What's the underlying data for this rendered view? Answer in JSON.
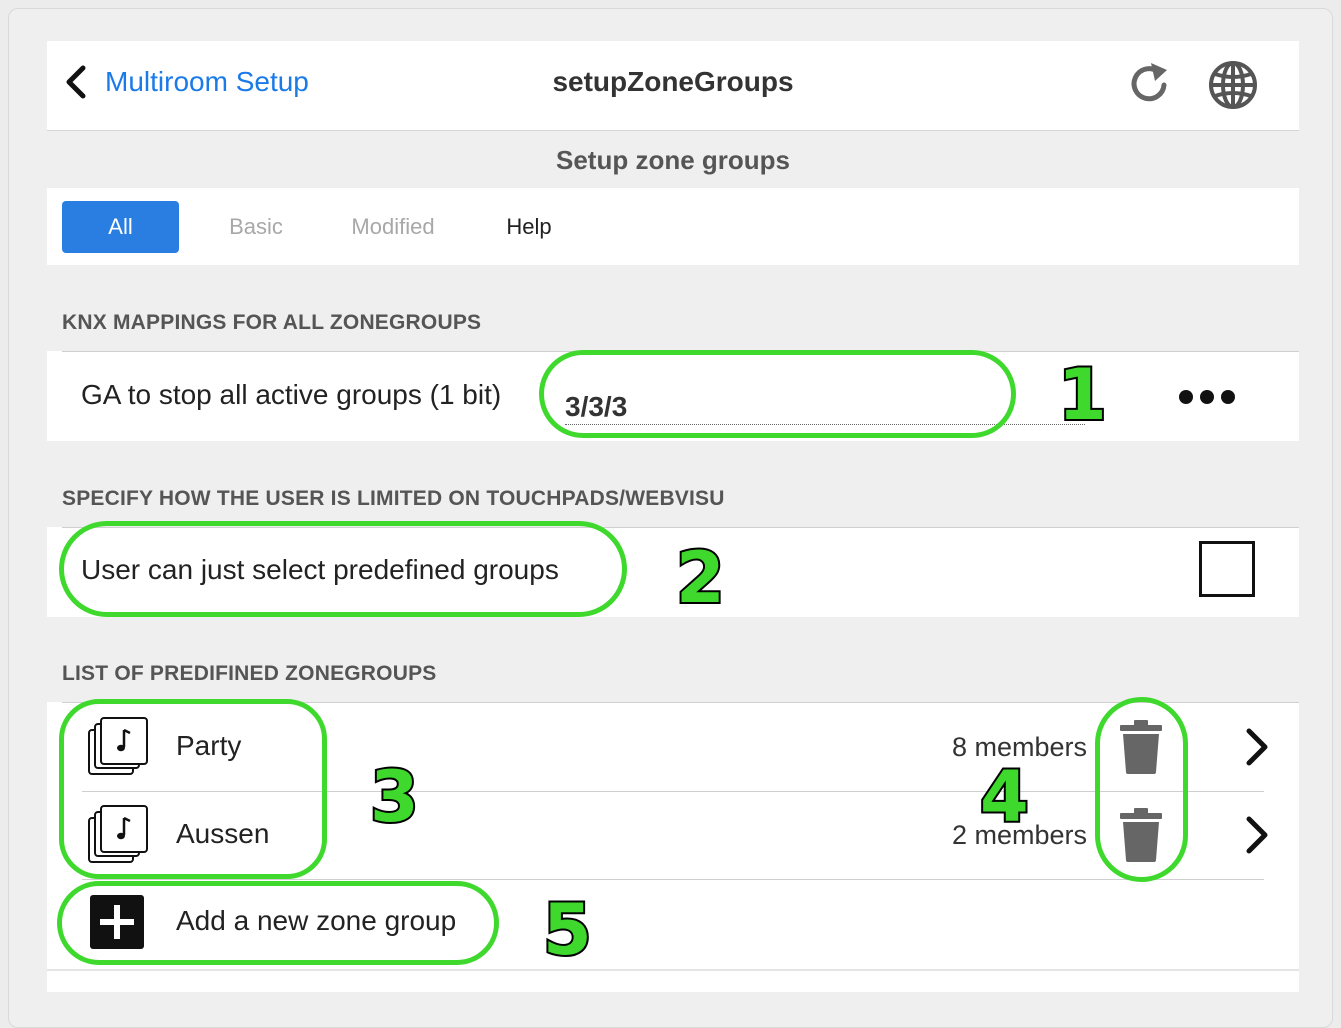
{
  "nav": {
    "back_label": "Multiroom Setup",
    "title": "setupZoneGroups",
    "icons": [
      "chevron-left-icon",
      "reload-icon",
      "globe-icon"
    ]
  },
  "section_title": "Setup zone groups",
  "tabs": [
    {
      "label": "All",
      "state": "active"
    },
    {
      "label": "Basic",
      "state": "dim"
    },
    {
      "label": "Modified",
      "state": "dim"
    },
    {
      "label": "Help",
      "state": "normal"
    }
  ],
  "knx": {
    "header": "KNX MAPPINGS FOR ALL ZONEGROUPS",
    "ga_label": "GA to stop all active groups (1 bit)",
    "ga_value": "3/3/3"
  },
  "limit": {
    "header": "SPECIFY HOW THE USER IS LIMITED ON TOUCHPADS/WEBVISU",
    "option_label": "User can just select predefined groups",
    "checked": false
  },
  "zonegroups": {
    "header": "LIST OF PREDIFINED ZONEGROUPS",
    "items": [
      {
        "name": "Party",
        "members": "8 members"
      },
      {
        "name": "Aussen",
        "members": "2 members"
      }
    ],
    "add_label": "Add a new zone group"
  },
  "annotations": {
    "numbers": [
      "1",
      "2",
      "3",
      "4",
      "5"
    ],
    "highlight_color": "#3fd92e",
    "accent_color": "#1a7ae8"
  }
}
